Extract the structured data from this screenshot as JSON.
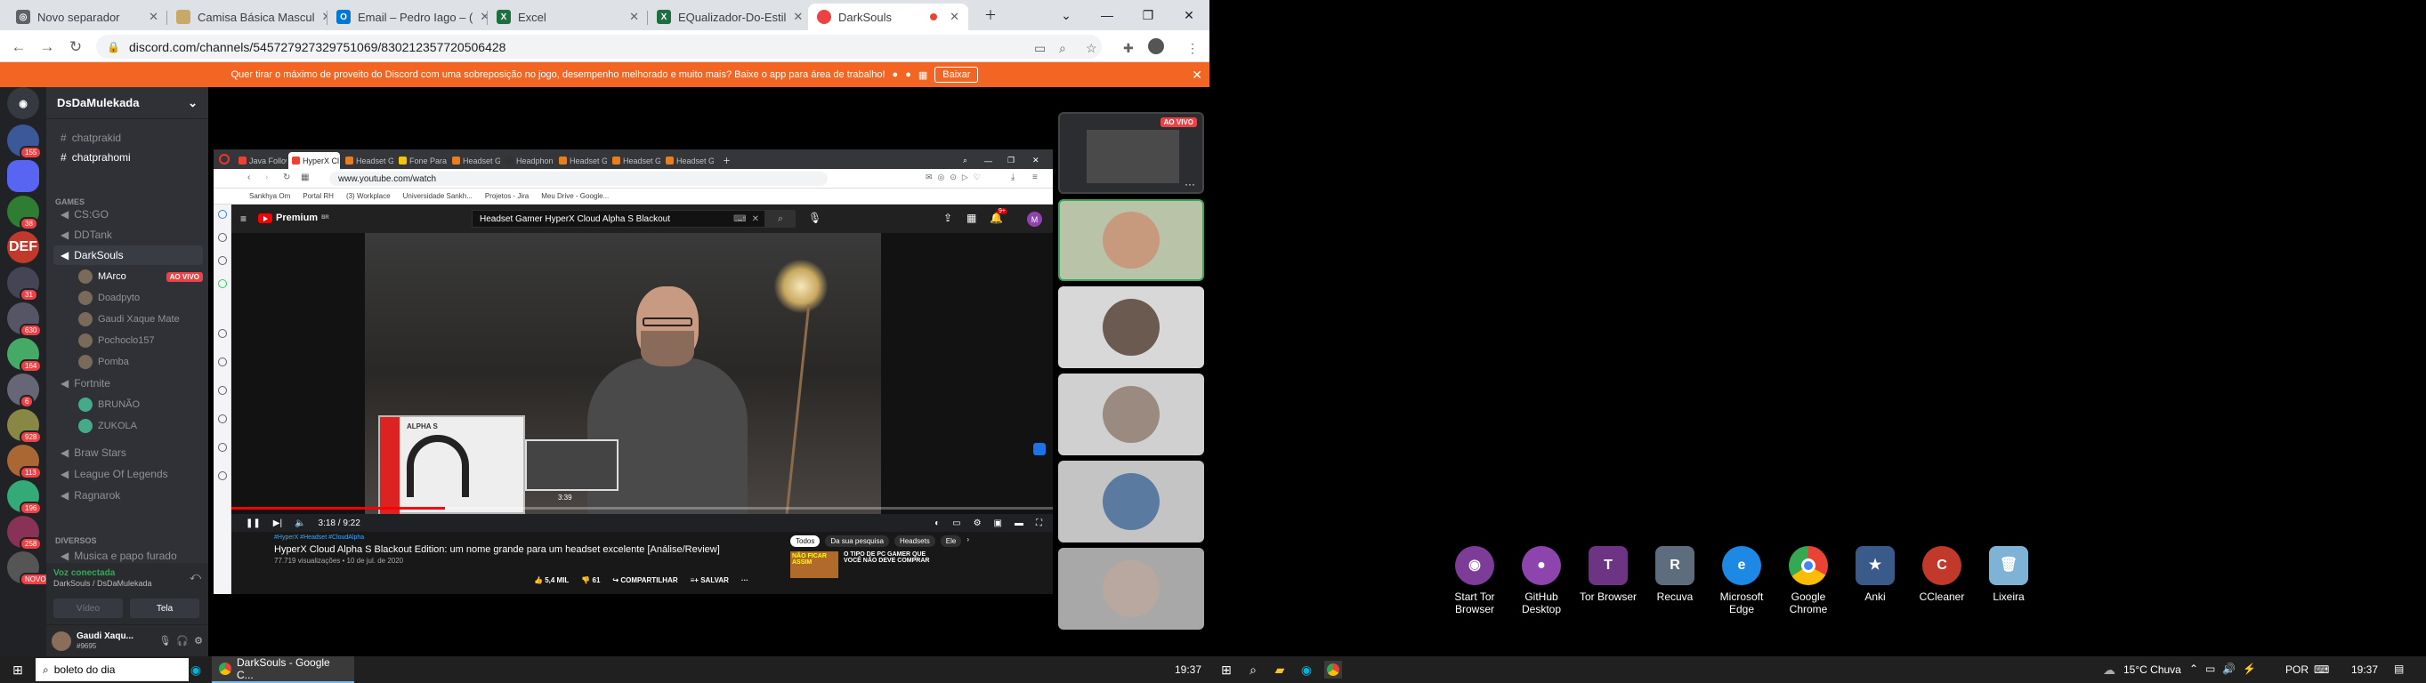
{
  "browser": {
    "tabs": [
      {
        "label": "Novo separador",
        "color": "#5f6368"
      },
      {
        "label": "Camisa Básica Mascul",
        "color": "#c8a96a"
      },
      {
        "label": "Email – Pedro Iago – (",
        "color": "#0078d4"
      },
      {
        "label": "Excel",
        "color": "#1d6f42"
      },
      {
        "label": "EQualizador-Do-Estil",
        "color": "#1d6f42"
      },
      {
        "label": "DarkSouls",
        "color": "#5865f2"
      }
    ],
    "url": "discord.com/channels/545727927329751069/830212357720506428"
  },
  "banner": {
    "text": "Quer tirar o máximo de proveito do Discord com uma sobreposição no jogo, desempenho melhorado e muito mais? Baixe o app para área de trabalho!",
    "button": "Baixar"
  },
  "discord": {
    "server_name": "DsDaMulekada",
    "channels_top": [
      "chatprakid",
      "chatprahomi"
    ],
    "category_games": "GAMES",
    "game_channels": [
      "CS:GO",
      "DDTank",
      "DarkSouls"
    ],
    "darksouls_users": [
      {
        "name": "MArco",
        "live": "AO VIVO"
      },
      {
        "name": "Doadpyto"
      },
      {
        "name": "Gaudi Xaque Mate"
      },
      {
        "name": "Pochoclo157"
      },
      {
        "name": "Pomba"
      }
    ],
    "fortnite": "Fortnite",
    "fortnite_users": [
      "BRUNÃO",
      "ZUKOLA"
    ],
    "more_channels": [
      "Braw Stars",
      "League Of Legends",
      "Ragnarok"
    ],
    "category_diversos": "DIVERSOS",
    "diversos_first": "Musica e papo furado",
    "voice_status": "Voz conectada",
    "voice_channel": "DarkSouls / DsDaMulekada",
    "video_btn": "Vídeo",
    "screen_btn": "Tela",
    "username": "Gaudi Xaqu...",
    "user_tag": "#9695",
    "guild_badges": [
      "155",
      "38",
      "31",
      "630",
      "164",
      "6",
      "928",
      "113",
      "196",
      "258",
      "NOVO"
    ],
    "live_badge": "AO VIVO"
  },
  "share": {
    "tabs": [
      "Java Follow",
      "HyperX Cl",
      "Headset G",
      "Fone Para",
      "Headset G",
      "Headphon",
      "Headset G",
      "Headset G",
      "Headset G"
    ],
    "url": "www.youtube.com/watch",
    "bookmarks": [
      "Sankhya Om",
      "Portal RH",
      "(3) Workplace",
      "Universidade Sankh...",
      "Projetos - Jira",
      "Meu Drive - Google..."
    ],
    "yt_premium": "Premium",
    "yt_country": "BR",
    "yt_search": "Headset Gamer HyperX Cloud Alpha S Blackout",
    "avatar_letter": "M",
    "notif_count": "9+",
    "time": "3:18 / 9:22",
    "preview_time": "3:39",
    "box_text": "ALPHA S",
    "hashtags": "#HyperX #Headset #CloudAlpha",
    "video_title": "HyperX Cloud Alpha S Blackout Edition: um nome grande para um headset excelente [Análise/Review]",
    "video_meta": "77.719 visualizações • 10 de jul. de 2020",
    "likes": "5,4 MIL",
    "dislikes": "61",
    "share_label": "COMPARTILHAR",
    "save_label": "SALVAR",
    "chips": [
      "Todos",
      "Da sua pesquisa",
      "Headsets",
      "Ele"
    ],
    "rec_title": "O TIPO DE PC GAMER QUE VOCÊ NÃO DEVE COMPRAR",
    "rec_thumb_text": "NÃO FICAR ASSIM",
    "progress_fraction": 0.26
  },
  "desktop_icons": [
    {
      "label": "Start Tor Browser",
      "color": "#7d3c98"
    },
    {
      "label": "GitHub Desktop",
      "color": "#8e44ad"
    },
    {
      "label": "Tor Browser",
      "color": "#6c3483"
    },
    {
      "label": "Recuva",
      "color": "#5d6d7e"
    },
    {
      "label": "Microsoft Edge",
      "color": "#1e88e5"
    },
    {
      "label": "Google Chrome",
      "color": "#e74c3c"
    },
    {
      "label": "Anki",
      "color": "#3a5a8a"
    },
    {
      "label": "CCleaner",
      "color": "#c0392b"
    },
    {
      "label": "Lixeira",
      "color": "#7fb3d5"
    }
  ],
  "taskbar": {
    "search_placeholder": "boleto do dia",
    "chrome_label": "DarkSouls - Google C...",
    "clock_center": "19:37",
    "weather": "15°C Chuva",
    "lang": "POR",
    "clock_right": "19:37"
  }
}
